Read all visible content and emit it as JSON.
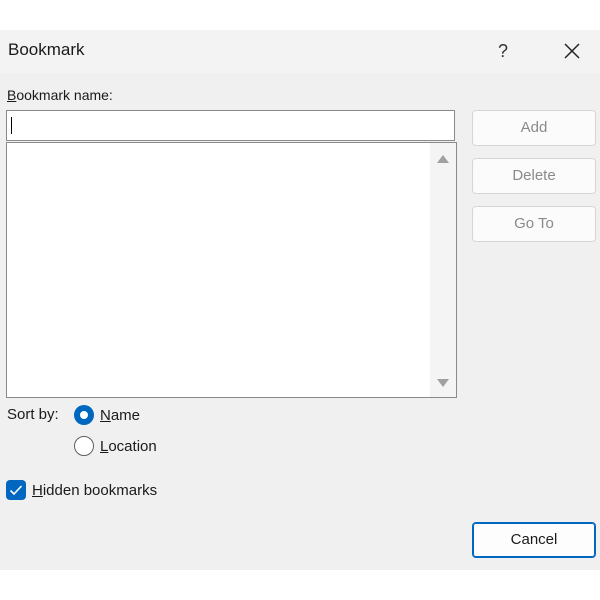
{
  "window": {
    "title": "Bookmark",
    "help_symbol": "?",
    "close_icon": "close-icon"
  },
  "bookmark_name": {
    "label_first": "B",
    "label_rest": "ookmark name:",
    "value": ""
  },
  "bookmark_list": {
    "items": []
  },
  "buttons": {
    "add": "Add",
    "delete": "Delete",
    "goto": "Go To",
    "cancel": "Cancel"
  },
  "sort": {
    "label": "Sort by:",
    "options": [
      {
        "accel": "N",
        "rest": "ame",
        "selected": true
      },
      {
        "accel": "L",
        "rest": "ocation",
        "selected": false
      }
    ]
  },
  "hidden_bookmarks": {
    "accel": "H",
    "rest": "idden bookmarks",
    "checked": true
  },
  "colors": {
    "accent": "#0067c0",
    "disabled_text": "#8a8a8a",
    "dialog_bg": "#f0f0f0"
  }
}
